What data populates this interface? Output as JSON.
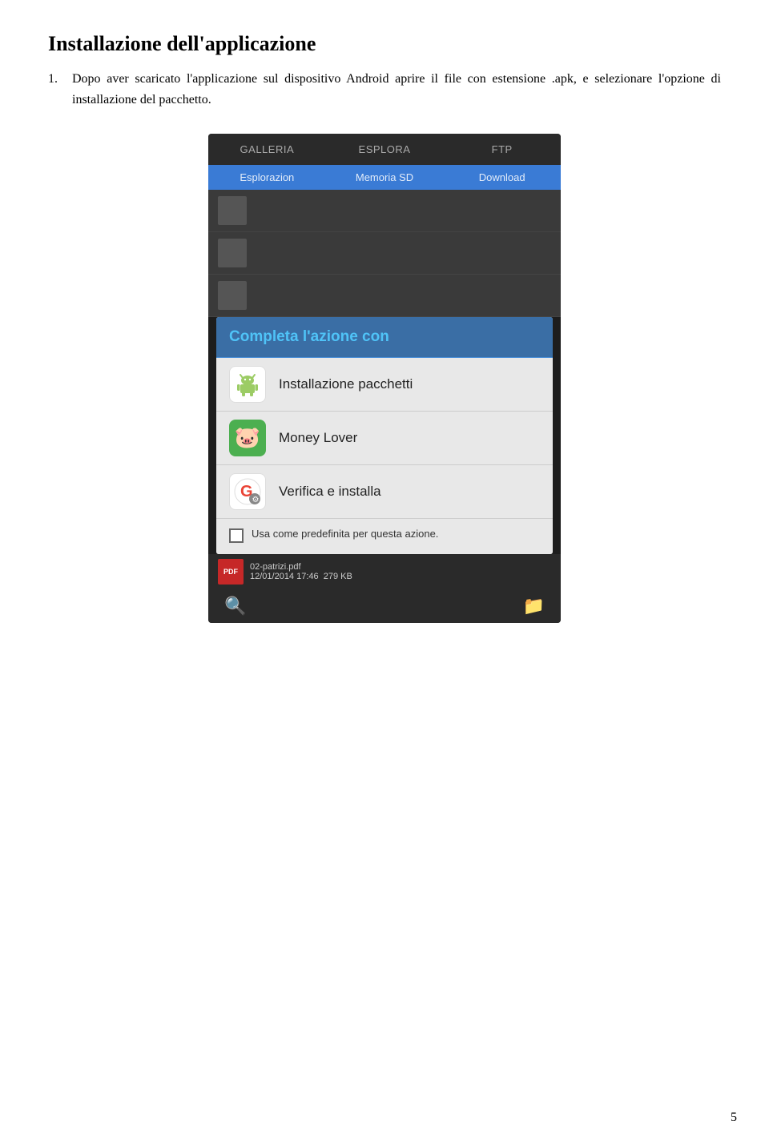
{
  "page": {
    "title": "Installazione dell'applicazione",
    "page_number": "5"
  },
  "instruction": {
    "number": "1.",
    "text": "Dopo  aver  scaricato  l'applicazione  sul  dispositivo  Android  aprire  il  file  con estensione  .apk,  e  selezionare  l'opzione  di  installazione  del  pacchetto."
  },
  "screenshot": {
    "tabs": [
      "GALLERIA",
      "ESPLORA",
      "FTP"
    ],
    "sub_tabs": [
      "Esplorazion",
      "Memoria SD",
      "Download"
    ],
    "modal": {
      "title": "Completa l'azione con",
      "options": [
        {
          "id": "installazione-pacchetti",
          "label": "Installazione pacchetti",
          "icon_type": "android"
        },
        {
          "id": "money-lover",
          "label": "Money Lover",
          "icon_type": "money"
        },
        {
          "id": "verifica-installa",
          "label": "Verifica e installa",
          "icon_type": "google"
        }
      ],
      "checkbox_label": "Usa come predefinita per questa azione."
    },
    "file": {
      "name": "02-patrizi.pdf",
      "date": "12/01/2014 17:46",
      "size": "279 KB"
    }
  }
}
